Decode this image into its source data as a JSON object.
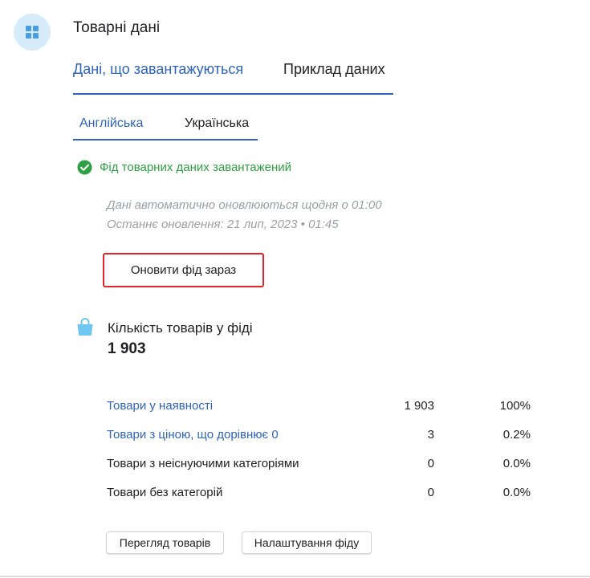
{
  "header": {
    "title": "Товарні дані",
    "avatar_icon": "grid-icon",
    "avatar_bg": "#d7ecfb"
  },
  "main_tabs": [
    {
      "label": "Дані, що завантажуються",
      "active": true
    },
    {
      "label": "Приклад даних",
      "active": false
    }
  ],
  "language_tabs": [
    {
      "label": "Англійська",
      "active": true
    },
    {
      "label": "Українська",
      "active": false
    }
  ],
  "status": {
    "icon": "check-circle-icon",
    "text": "Фід товарних даних завантажений",
    "color": "#2ea043"
  },
  "info": {
    "auto_update": "Дані автоматично оновлюються щодня о 01:00",
    "last_update": "Останнє оновлення: 21 лип, 2023 • 01:45"
  },
  "refresh_button": {
    "label": "Оновити фід зараз"
  },
  "product_count": {
    "icon": "shopping-bag-icon",
    "label": "Кількість товарів у фіді",
    "value": "1 903"
  },
  "stats": [
    {
      "label": "Товари у наявності",
      "count": "1 903",
      "percent": "100%",
      "link": true
    },
    {
      "label": "Товари з ціною, що дорівнює 0",
      "count": "3",
      "percent": "0.2%",
      "link": true
    },
    {
      "label": "Товари з неіснуючими категоріями",
      "count": "0",
      "percent": "0.0%",
      "link": false
    },
    {
      "label": "Товари без категорій",
      "count": "0",
      "percent": "0.0%",
      "link": false
    }
  ],
  "buttons": {
    "view_products": "Перегляд товарів",
    "feed_settings": "Налаштування фіду"
  },
  "colors": {
    "accent": "#2f63b8",
    "success": "#2ea043",
    "highlight_border": "#e0242a",
    "muted_text": "#9aa0a6"
  }
}
